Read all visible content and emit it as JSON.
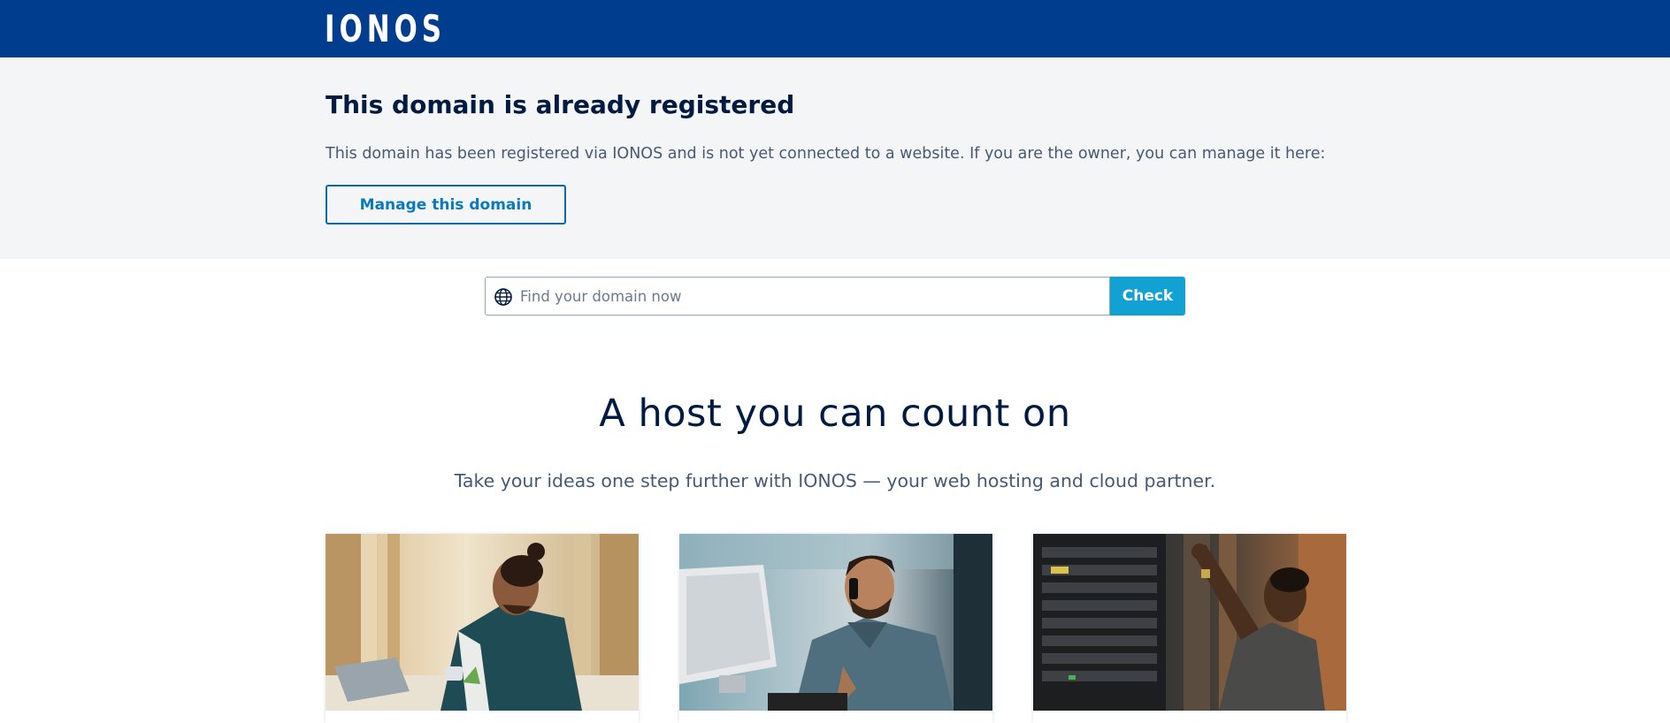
{
  "header": {
    "logo_text": "IONOS",
    "background_color": "#003d8f"
  },
  "notice": {
    "title": "This domain is already registered",
    "text": "This domain has been registered via IONOS and is not yet connected to a website. If you are the owner, you can manage it here:",
    "manage_button_label": "Manage this domain"
  },
  "search": {
    "icon": "globe-icon",
    "placeholder": "Find your domain now",
    "value": "",
    "button_label": "Check",
    "button_color": "#11a1d3"
  },
  "hero": {
    "headline": "A host you can count on",
    "subline": "Take your ideas one step further with IONOS — your web hosting and cloud partner."
  },
  "cards": [
    {
      "image": "man-working-at-desk-with-laptop-photo"
    },
    {
      "image": "man-on-phone-at-computer-photo"
    },
    {
      "image": "technician-at-server-rack-photo"
    }
  ]
}
